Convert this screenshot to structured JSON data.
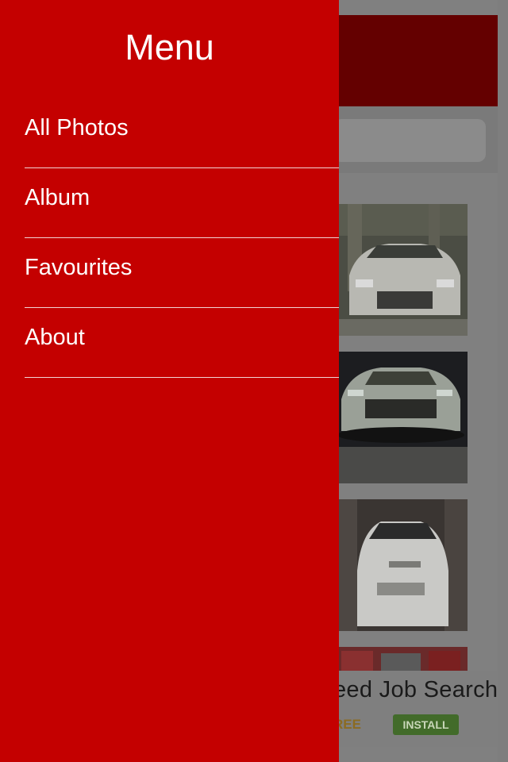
{
  "drawer": {
    "title": "Menu",
    "items": [
      {
        "label": "All Photos"
      },
      {
        "label": "Album"
      },
      {
        "label": "Favourites"
      },
      {
        "label": "About"
      }
    ]
  },
  "ad": {
    "headline": "eed Job Search",
    "badge": "REE",
    "install_label": "INSTALL"
  },
  "colors": {
    "drawer_bg": "#c40000",
    "header_dimmed": "#640000",
    "overlay": "#808080"
  }
}
